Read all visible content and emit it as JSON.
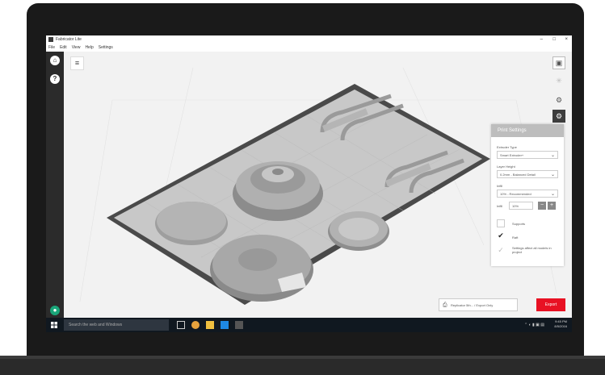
{
  "window": {
    "title": "Fabricator Lite",
    "minimize": "–",
    "maximize": "□",
    "close": "×"
  },
  "menu": [
    "File",
    "Edit",
    "View",
    "Help",
    "Settings"
  ],
  "print_settings": {
    "header": "Print Settings",
    "extruder_label": "Extruder Type",
    "extruder_value": "Smart Extruder+",
    "layer_label": "Layer Height",
    "layer_value": "0.2mm - Balanced Detail",
    "infill_label": "Infill",
    "infill_value": "10% - Recommended",
    "infill_count_label": "Infill",
    "infill_count_value": "10%",
    "supports_label": "Supports",
    "raft_label": "Raft",
    "raft_checked": true,
    "supports_checked": false,
    "settings_note": "Settings affect all models in project"
  },
  "export": {
    "printer_label": "Replicator 5th... / Export Only",
    "button": "Export"
  },
  "taskbar": {
    "search_placeholder": "Search the web and Windows",
    "time": "9:45 PM",
    "date": "8/5/2016"
  },
  "icons": {
    "rail": [
      "home-icon",
      "help-icon",
      "account-icon"
    ],
    "tools": [
      "view-cube-icon",
      "object-icon",
      "settings-gear-icon",
      "print-settings-icon",
      "scale-icon",
      "rotate-icon",
      "arrange-icon"
    ]
  },
  "colors": {
    "accent": "#e81123",
    "panel_header": "#bdbdbd",
    "rail": "#2b2b2b",
    "taskbar": "#101820"
  }
}
